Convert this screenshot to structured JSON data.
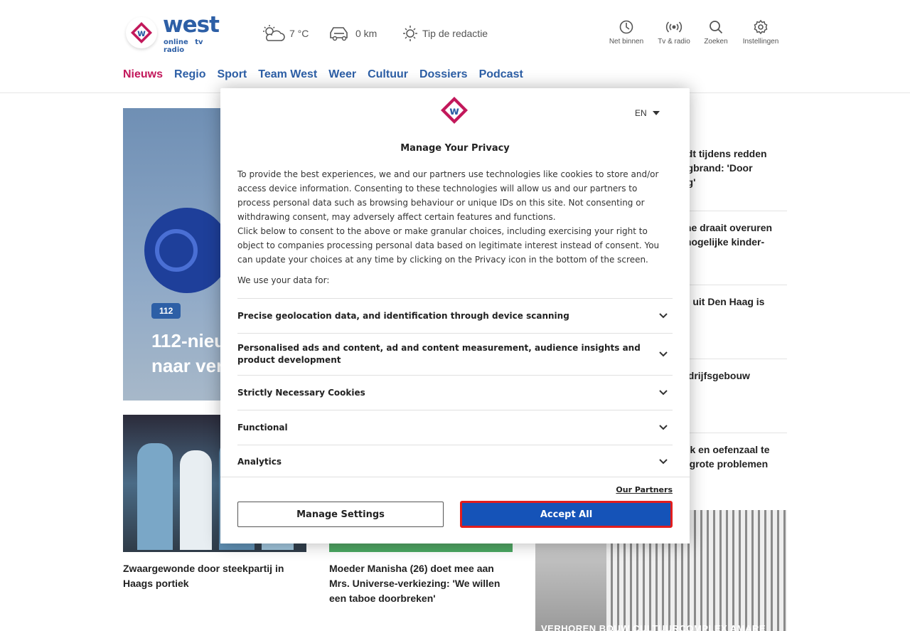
{
  "header": {
    "logo_text": "west",
    "logo_sub": "online tv radio",
    "weather": "7 °C",
    "traffic": "0 km",
    "tip": "Tip de redactie",
    "icons": [
      {
        "label": "Net binnen",
        "icon": "clock-icon"
      },
      {
        "label": "Tv & radio",
        "icon": "broadcast-icon"
      },
      {
        "label": "Zoeken",
        "icon": "search-icon"
      },
      {
        "label": "Instellingen",
        "icon": "gear-icon"
      }
    ]
  },
  "nav": {
    "items": [
      "Nieuws",
      "Regio",
      "Sport",
      "Team West",
      "Weer",
      "Cultuur",
      "Dossiers",
      "Podcast"
    ]
  },
  "hero": {
    "tag": "112",
    "title_visible": "112-nieu\nnaar ver"
  },
  "cards": [
    {
      "title": "Zwaargewonde door steekpartij in Haags portiek"
    },
    {
      "title": "Moeder Manisha (26) doet mee aan Mrs. Universe-verkiezing: 'We willen een taboe doorbreken'"
    }
  ],
  "sidebar": {
    "items": [
      {
        "title_visible": "ijdt tijdens redden\nngbrand: 'Door\nog'"
      },
      {
        "title_visible": "ine draait overuren\nmogelijke kinder-"
      },
      {
        "title_visible": "5) uit Den Haag is"
      },
      {
        "title_visible": "edrijfsgebouw\nt"
      },
      {
        "title_visible": "uik en oefenzaal te\ns grote problemen"
      }
    ],
    "photo_caption": "VERHOREN BOUW CULTUURCOMPLEX AMARE"
  },
  "modal": {
    "language": "EN",
    "title": "Manage Your Privacy",
    "paragraph1": "To provide the best experiences, we and our partners use technologies like cookies to store and/or access device information. Consenting to these technologies will allow us and our partners to process personal data such as browsing behaviour or unique IDs on this site. Not consenting or withdrawing consent, may adversely affect certain features and functions.",
    "paragraph2": "Click below to consent to the above or make granular choices, including exercising your right to object to companies processing personal data based on legitimate interest instead of consent. You can update your choices at any time by clicking on the Privacy icon in the bottom of the screen.",
    "use_label": "We use your data for:",
    "purposes": [
      "Precise geolocation data, and identification through device scanning",
      "Personalised ads and content, ad and content measurement, audience insights and product development",
      "Strictly Necessary Cookies",
      "Functional",
      "Analytics"
    ],
    "partners_link": "Our Partners",
    "manage_button": "Manage Settings",
    "accept_button": "Accept All"
  },
  "colors": {
    "brand_blue": "#2d5fa6",
    "brand_pink": "#c2185b",
    "accept_blue": "#1553b8",
    "accept_highlight": "#e21d1d"
  }
}
